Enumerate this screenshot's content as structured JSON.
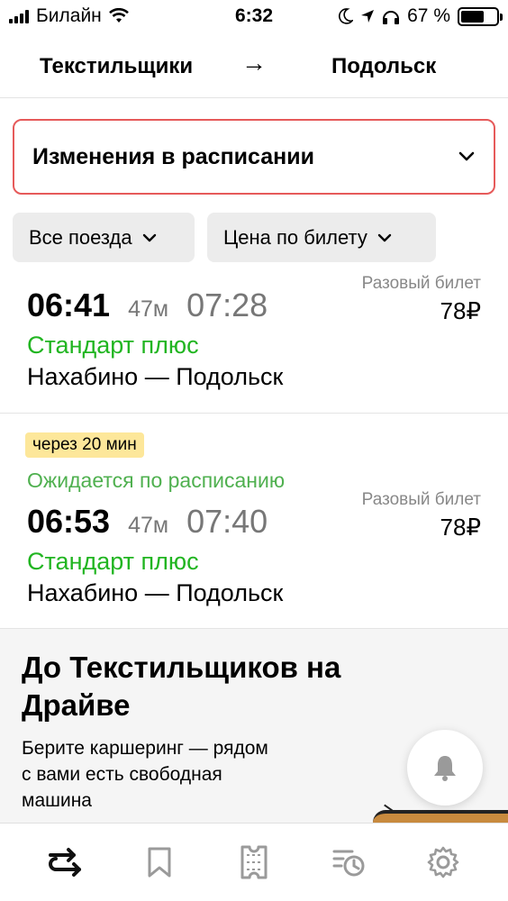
{
  "status_bar": {
    "carrier": "Билайн",
    "time": "6:32",
    "battery_percent": "67 %",
    "battery_level": 0.67
  },
  "route": {
    "from": "Текстильщики",
    "arrow": "→",
    "to": "Подольск"
  },
  "changes_dropdown": {
    "label": "Изменения в расписании"
  },
  "filters": {
    "trains": "Все поезда",
    "price": "Цена по билету"
  },
  "trains": [
    {
      "departure": "06:41",
      "duration": "47м",
      "arrival": "07:28",
      "class": "Стандарт плюс",
      "route": "Нахабино — Подольск",
      "price_label": "Разовый билет",
      "price": "78₽"
    },
    {
      "badge": "через 20 мин",
      "status": "Ожидается по расписанию",
      "departure": "06:53",
      "duration": "47м",
      "arrival": "07:40",
      "class": "Стандарт плюс",
      "route": "Нахабино — Подольск",
      "price_label": "Разовый билет",
      "price": "78₽"
    }
  ],
  "promo": {
    "title": "До Текстильщиков на Драйве",
    "text": "Берите каршеринг — рядом с вами есть свободная машина"
  },
  "tabbar": {
    "items": [
      "routes-icon",
      "bookmark-icon",
      "ticket-icon",
      "history-icon",
      "settings-icon"
    ]
  },
  "colors": {
    "accent_red": "#e65a5a",
    "green": "#21b521",
    "badge_yellow": "#fde79a"
  }
}
